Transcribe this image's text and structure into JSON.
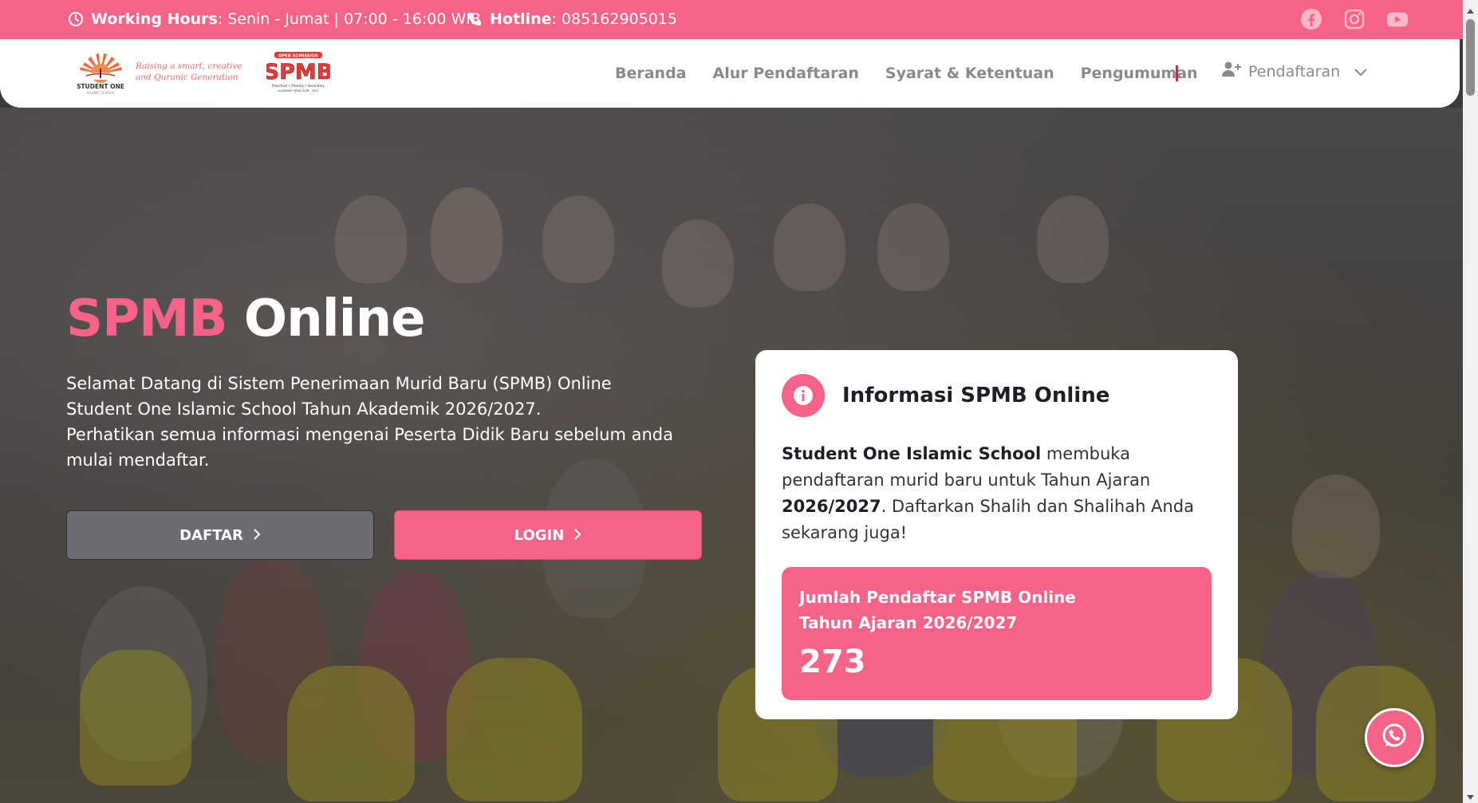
{
  "topbar": {
    "hours_label": "Working Hours",
    "hours_value": ": Senin - Jumat | 07:00 - 16:00 WIB",
    "hotline_label": "Hotline",
    "hotline_value": ": 085162905015",
    "socials": [
      "facebook-icon",
      "instagram-icon",
      "youtube-icon"
    ]
  },
  "logo": {
    "name": "STUDENT ONE",
    "subtitle": "ISLAMIC SCHOOL",
    "tagline_1": "Raising a smart, creative",
    "tagline_2": "and Quranic Generation",
    "spmb_top": "OPEN ADMISSION",
    "spmb_main": "SPMB",
    "spmb_sub": "Preschool • Primary • Secondary",
    "spmb_year": "ACADEMIC YEAR 2026 - 2027"
  },
  "nav": {
    "links": [
      "Beranda",
      "Alur Pendaftaran",
      "Syarat & Ketentuan",
      "Pengumuman"
    ],
    "dropdown_label": "Pendaftaran"
  },
  "hero": {
    "title_accent": "SPMB",
    "title_rest": "Online",
    "desc_line_1": "Selamat Datang di Sistem Penerimaan Murid Baru (SPMB) Online",
    "desc_line_2": "Student One Islamic School Tahun Akademik 2026/2027.",
    "desc_line_3": "Perhatikan semua informasi mengenai Peserta Didik Baru sebelum anda mulai mendaftar.",
    "btn_daftar": "DAFTAR",
    "btn_login": "LOGIN"
  },
  "card": {
    "title": "Informasi SPMB Online",
    "school": "Student One Islamic School",
    "text_1": " membuka pendaftaran murid baru untuk Tahun Ajaran ",
    "year": "2026/2027",
    "text_2": ". Daftarkan Shalih dan Shalihah Anda sekarang juga!",
    "stat_label_1": "Jumlah Pendaftar SPMB Online",
    "stat_label_2": "Tahun Ajaran 2026/2027",
    "stat_value": "273"
  },
  "colors": {
    "accent": "#f76386",
    "button_gray": "#6d6c72",
    "nav_text": "#8a8a8a"
  }
}
